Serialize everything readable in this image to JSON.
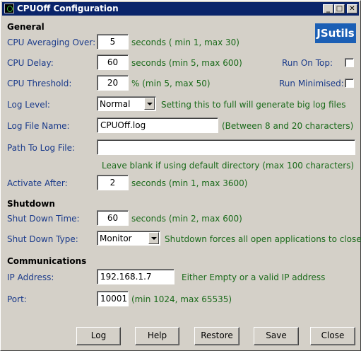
{
  "window": {
    "title": "CPUOff Configuration",
    "minimize": "_",
    "maximize": "□",
    "close": "✕"
  },
  "logo": {
    "text": "JSutils",
    "color": "#1b5fb5"
  },
  "general": {
    "heading": "General",
    "averaging": {
      "label": "CPU Averaging Over:",
      "value": "5",
      "hint": "seconds ( min 1, max 30)"
    },
    "delay": {
      "label": "CPU Delay:",
      "value": "60",
      "hint": "seconds (min 5, max 600)"
    },
    "threshold": {
      "label": "CPU Threshold:",
      "value": "20",
      "hint": "% (min 5, max 50)"
    },
    "run_on_top": {
      "label": "Run On Top:",
      "checked": false
    },
    "run_minimised": {
      "label": "Run Minimised:",
      "checked": false
    },
    "log_level": {
      "label": "Log Level:",
      "value": "Normal",
      "hint": "Setting this to full will generate big log files"
    },
    "log_file_name": {
      "label": "Log File Name:",
      "value": "CPUOff.log",
      "hint": "(Between 8 and 20 characters)"
    },
    "log_path": {
      "label": "Path To Log File:",
      "value": "",
      "hint": "Leave blank if using default directory (max 100 characters)"
    },
    "activate_after": {
      "label": "Activate After:",
      "value": "2",
      "hint": "seconds (min 1, max 3600)"
    }
  },
  "shutdown": {
    "heading": "Shutdown",
    "time": {
      "label": "Shut Down Time:",
      "value": "60",
      "hint": "seconds (min 2, max 600)"
    },
    "type": {
      "label": "Shut Down Type:",
      "value": "Monitor",
      "hint": "Shutdown forces all open applications to close"
    }
  },
  "communications": {
    "heading": "Communications",
    "ip": {
      "label": "IP Address:",
      "value": "192.168.1.7",
      "hint": "Either Empty or a valid IP address"
    },
    "port": {
      "label": "Port:",
      "value": "10001",
      "hint": "(min 1024, max 65535)"
    }
  },
  "buttons": {
    "log": "Log",
    "help": "Help",
    "restore": "Restore",
    "save": "Save",
    "close": "Close"
  },
  "colors": {
    "label": "#1a3a8a",
    "hint": "#1a6a1a",
    "titlebar": "#0a246a",
    "face": "#d4d0c8"
  }
}
